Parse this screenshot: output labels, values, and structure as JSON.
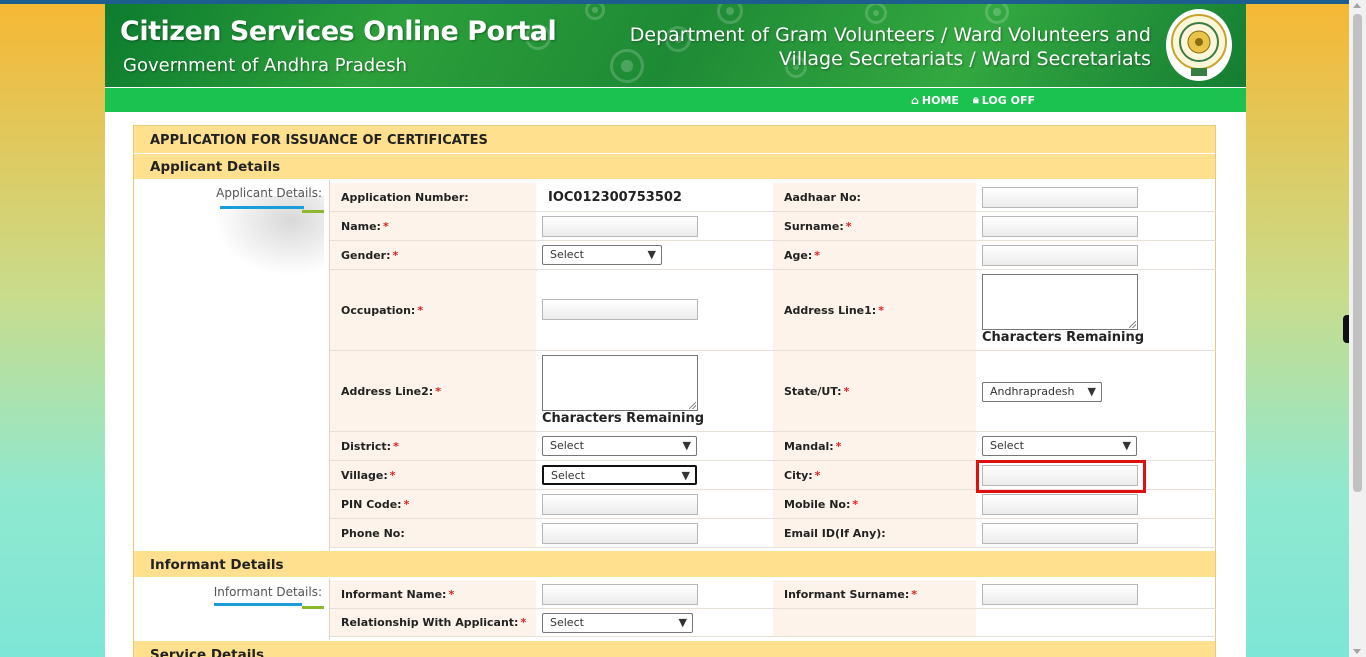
{
  "header": {
    "portal_title": "Citizen Services Online Portal",
    "portal_subtitle": "Government of Andhra Pradesh",
    "dept_line1": "Department of Gram Volunteers / Ward Volunteers and",
    "dept_line2": "Village Secretariats / Ward Secretariats",
    "emblem_icon": "andhra-pradesh-emblem"
  },
  "nav": {
    "home": "HOME",
    "home_icon": "home-icon",
    "logoff": "LOG OFF",
    "logoff_icon": "lock-icon"
  },
  "form": {
    "title": "APPLICATION FOR ISSUANCE OF CERTIFICATES",
    "applicant_section": "Applicant Details",
    "applicant_side_label": "Applicant Details:",
    "informant_section": "Informant Details",
    "informant_side_label": "Informant Details:",
    "service_section": "Service Details",
    "required_mark": "*",
    "chars_remaining": "Characters Remaining",
    "fields": {
      "application_number_label": "Application Number:",
      "application_number_value": "IOC012300753502",
      "aadhaar_label": "Aadhaar No:",
      "name_label": "Name:",
      "surname_label": "Surname:",
      "gender_label": "Gender:",
      "gender_value": "Select",
      "age_label": "Age:",
      "occupation_label": "Occupation:",
      "address1_label": "Address Line1:",
      "address2_label": "Address Line2:",
      "state_label": "State/UT:",
      "state_value": "Andhrapradesh",
      "district_label": "District:",
      "district_value": "Select",
      "mandal_label": "Mandal:",
      "mandal_value": "Select",
      "village_label": "Village:",
      "village_value": "Select",
      "city_label": "City:",
      "pin_label": "PIN Code:",
      "mobile_label": "Mobile No:",
      "phone_label": "Phone No:",
      "email_label": "Email ID(If Any):",
      "informant_name_label": "Informant Name:",
      "informant_surname_label": "Informant Surname:",
      "relationship_label": "Relationship With Applicant:",
      "relationship_value": "Select"
    }
  },
  "colors": {
    "section_bar": "#fee08e",
    "label_bg": "#fdf3ea",
    "nav_green": "#1cc24f",
    "highlight": "#e01010"
  }
}
